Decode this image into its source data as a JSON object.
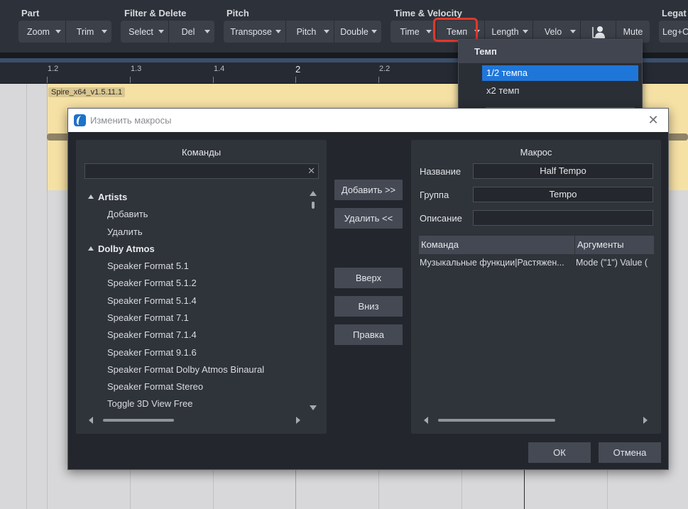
{
  "toolbar": {
    "groups": {
      "part": "Part",
      "filter": "Filter & Delete",
      "pitch": "Pitch",
      "time_velocity": "Time & Velocity",
      "legato": "Legat"
    },
    "buttons": {
      "zoom": "Zoom",
      "trim": "Trim",
      "select": "Select",
      "del": "Del",
      "transpose": "Transpose",
      "pitch": "Pitch",
      "double": "Double",
      "time": "Time",
      "tempo": "Темп",
      "length": "Length",
      "velo": "Velo",
      "mute": "Mute",
      "legato": "Leg+C"
    },
    "highlight_color": "#e0382c"
  },
  "ruler": {
    "ticks": [
      "1.2",
      "1.3",
      "1.4",
      "2",
      "2.2"
    ]
  },
  "clip": {
    "label": "Spire_x64_v1.5.11.1"
  },
  "tempo_menu": {
    "header": "Темп",
    "items": [
      "1/2 темпа",
      "x2 темп"
    ],
    "selected_index": 0,
    "selected_color": "#1f76d9"
  },
  "dialog": {
    "title": "Изменить макросы",
    "commands_panel": {
      "title": "Команды",
      "search_value": "",
      "tree": [
        {
          "label": "Artists",
          "type": "category"
        },
        {
          "label": "Добавить",
          "type": "item"
        },
        {
          "label": "Удалить",
          "type": "item"
        },
        {
          "label": "Dolby Atmos",
          "type": "category"
        },
        {
          "label": "Speaker Format 5.1",
          "type": "item"
        },
        {
          "label": "Speaker Format 5.1.2",
          "type": "item"
        },
        {
          "label": "Speaker Format 5.1.4",
          "type": "item"
        },
        {
          "label": "Speaker Format 7.1",
          "type": "item"
        },
        {
          "label": "Speaker Format 7.1.4",
          "type": "item"
        },
        {
          "label": "Speaker Format 9.1.6",
          "type": "item"
        },
        {
          "label": "Speaker Format Dolby Atmos Binaural",
          "type": "item"
        },
        {
          "label": "Speaker Format Stereo",
          "type": "item"
        },
        {
          "label": "Toggle 3D View Free",
          "type": "item"
        }
      ]
    },
    "middle_buttons": {
      "add": "Добавить >>",
      "remove": "Удалить <<",
      "up": "Вверх",
      "down": "Вниз",
      "edit": "Правка"
    },
    "macro_panel": {
      "title": "Макрос",
      "name_label": "Название",
      "name_value": "Half Tempo",
      "group_label": "Группа",
      "group_value": "Tempo",
      "description_label": "Описание",
      "description_value": "",
      "table_headers": [
        "Команда",
        "Аргументы"
      ],
      "table_rows": [
        [
          "Музыкальные функции|Растяжен...",
          "Mode (\"1\") Value ("
        ]
      ]
    },
    "ok": "ОК",
    "cancel": "Отмена"
  }
}
